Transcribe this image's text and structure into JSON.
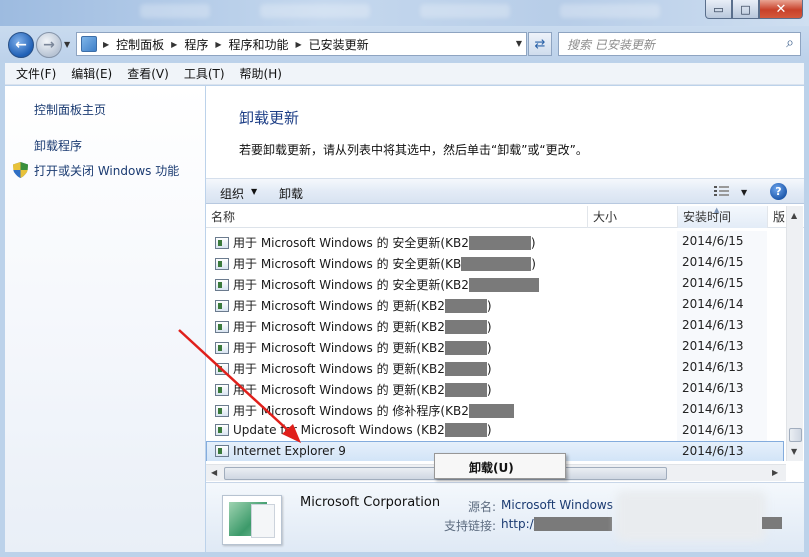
{
  "window": {
    "caption_minimize": "▭",
    "caption_maximize": "□",
    "caption_close": "✕"
  },
  "address_bar": {
    "crumbs": [
      "控制面板",
      "程序",
      "程序和功能",
      "已安装更新"
    ],
    "search_placeholder": "搜索 已安装更新"
  },
  "menu": [
    "文件(F)",
    "编辑(E)",
    "查看(V)",
    "工具(T)",
    "帮助(H)"
  ],
  "left_pane": {
    "home": "控制面板主页",
    "uninstall_program": "卸载程序",
    "windows_features": "打开或关闭 Windows 功能"
  },
  "content": {
    "title": "卸载更新",
    "description": "若要卸载更新，请从列表中将其选中，然后单击“卸载”或“更改”。"
  },
  "command_bar": {
    "organize": "组织",
    "uninstall": "卸载"
  },
  "columns": {
    "name": "名称",
    "size": "大小",
    "installed_on": "安装时间",
    "publisher": "版"
  },
  "rows": [
    {
      "prefix": "用于 Microsoft Windows 的 安全更新(KB2",
      "suffix": ")",
      "date": "2014/6/15"
    },
    {
      "prefix": "用于 Microsoft Windows 的 安全更新(KB",
      "suffix": ")",
      "date": "2014/6/15"
    },
    {
      "prefix": "用于 Microsoft Windows 的 安全更新(KB2",
      "suffix": "",
      "date": "2014/6/15"
    },
    {
      "prefix": "用于 Microsoft Windows 的 更新(KB2",
      "suffix": ")",
      "date": "2014/6/14"
    },
    {
      "prefix": "用于 Microsoft Windows 的 更新(KB2",
      "suffix": ")",
      "date": "2014/6/13"
    },
    {
      "prefix": "用于 Microsoft Windows 的 更新(KB2",
      "suffix": ")",
      "date": "2014/6/13"
    },
    {
      "prefix": "用于 Microsoft Windows 的 更新(KB2",
      "suffix": ")",
      "date": "2014/6/13"
    },
    {
      "prefix": "用于 Microsoft Windows 的 更新(KB2",
      "suffix": ")",
      "date": "2014/6/13"
    },
    {
      "prefix": "用于 Microsoft Windows 的 修补程序(KB2",
      "suffix": "",
      "date": "2014/6/13"
    },
    {
      "prefix": "Update for Microsoft Windows (KB2",
      "suffix": ")",
      "date": "2014/6/13"
    },
    {
      "prefix": "Internet Explorer 9",
      "suffix": "",
      "date": "2014/6/13",
      "selected": true
    }
  ],
  "context_menu": {
    "uninstall": "卸载(U)"
  },
  "details": {
    "company": "Microsoft Corporation",
    "publisher_label": "源名:",
    "publisher_value": "Microsoft Windows",
    "support_label": "支持链接:",
    "support_value": "http://"
  },
  "colors": {
    "accent": "#1e3f87",
    "link": "#1b3b72",
    "selection": "#d2e4f7",
    "annotation_arrow": "#e0201b"
  }
}
